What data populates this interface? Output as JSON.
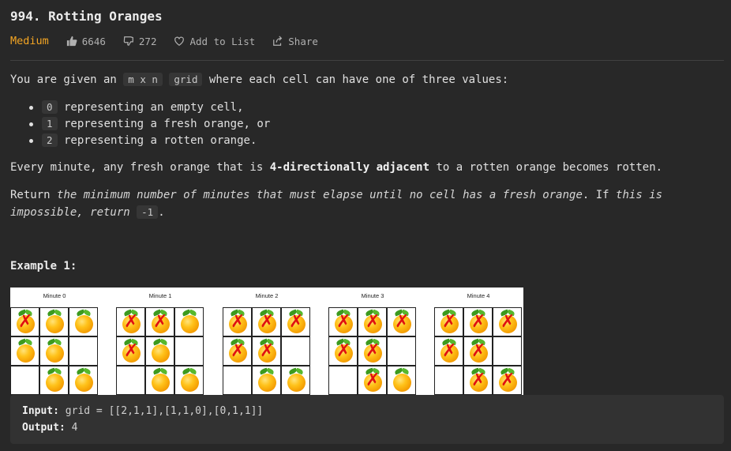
{
  "problem": {
    "title": "994. Rotting Oranges",
    "difficulty": "Medium",
    "likes": "6646",
    "dislikes": "272",
    "add_to_list": "Add to List",
    "share": "Share"
  },
  "description": {
    "intro_pre": "You are given an",
    "intro_code1": "m x n",
    "intro_code2": "grid",
    "intro_post": "where each cell can have one of three values:",
    "bullets": [
      {
        "code": "0",
        "text": "representing an empty cell,"
      },
      {
        "code": "1",
        "text": "representing a fresh orange, or"
      },
      {
        "code": "2",
        "text": "representing a rotten orange."
      }
    ],
    "rule_pre": "Every minute, any fresh orange that is",
    "rule_bold": "4-directionally adjacent",
    "rule_post": "to a rotten orange becomes rotten.",
    "return_pre": "Return",
    "return_italic1": "the minimum number of minutes that must elapse until no cell has a fresh orange",
    "return_mid": ". If",
    "return_italic2a": "this is",
    "return_italic2b": "impossible, return",
    "return_code": "-1",
    "return_end": "."
  },
  "example": {
    "title": "Example 1:",
    "panels": [
      {
        "label": "Minute 0",
        "cells": [
          2,
          1,
          1,
          1,
          1,
          0,
          0,
          1,
          1
        ]
      },
      {
        "label": "Minute 1",
        "cells": [
          2,
          2,
          1,
          2,
          1,
          0,
          0,
          1,
          1
        ]
      },
      {
        "label": "Minute 2",
        "cells": [
          2,
          2,
          2,
          2,
          2,
          0,
          0,
          1,
          1
        ]
      },
      {
        "label": "Minute 3",
        "cells": [
          2,
          2,
          2,
          2,
          2,
          0,
          0,
          2,
          1
        ]
      },
      {
        "label": "Minute 4",
        "cells": [
          2,
          2,
          2,
          2,
          2,
          0,
          0,
          2,
          2
        ]
      }
    ],
    "input_label": "Input:",
    "input_value": "grid = [[2,1,1],[1,1,0],[0,1,1]]",
    "output_label": "Output:",
    "output_value": "4"
  },
  "colors": {
    "background": "#282828",
    "difficulty": "#f5a623",
    "rotten_mark": "#e01010",
    "orange": "#ffb000"
  },
  "icons": {
    "like": "thumbs-up-icon",
    "dislike": "thumbs-down-icon",
    "add": "heart-icon",
    "share": "share-icon"
  }
}
